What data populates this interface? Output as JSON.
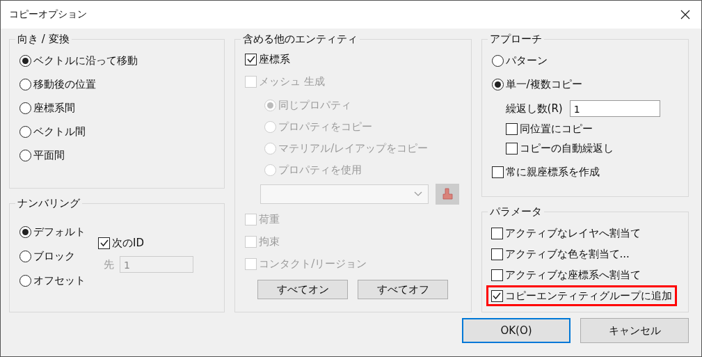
{
  "window": {
    "title": "コピーオプション"
  },
  "orientation": {
    "title": "向き / 変換",
    "options": [
      {
        "label": "ベクトルに沿って移動",
        "selected": true
      },
      {
        "label": "移動後の位置",
        "selected": false
      },
      {
        "label": "座標系間",
        "selected": false
      },
      {
        "label": "ベクトル間",
        "selected": false
      },
      {
        "label": "平面間",
        "selected": false
      }
    ]
  },
  "numbering": {
    "title": "ナンバリング",
    "options": [
      {
        "label": "デフォルト",
        "selected": true
      },
      {
        "label": "ブロック",
        "selected": false
      },
      {
        "label": "オフセット",
        "selected": false
      }
    ],
    "next_id": {
      "label": "次のID",
      "checked": true
    },
    "start": {
      "label": "先",
      "value": "1",
      "disabled": true
    }
  },
  "entities": {
    "title": "含める他のエンティティ",
    "items": [
      {
        "kind": "checkbox",
        "label": "座標系",
        "checked": true,
        "disabled": false
      },
      {
        "kind": "checkbox",
        "label": "メッシュ 生成",
        "checked": false,
        "disabled": true,
        "children": [
          {
            "kind": "radio",
            "label": "同じプロパティ",
            "selected": true,
            "disabled": true
          },
          {
            "kind": "radio",
            "label": "プロパティをコピー",
            "selected": false,
            "disabled": true
          },
          {
            "kind": "radio",
            "label": "マテリアル/レイアップをコピー",
            "selected": false,
            "disabled": true
          },
          {
            "kind": "radio",
            "label": "プロパティを使用",
            "selected": false,
            "disabled": true
          },
          {
            "kind": "combo",
            "disabled": true
          }
        ]
      },
      {
        "kind": "checkbox",
        "label": "荷重",
        "checked": false,
        "disabled": true
      },
      {
        "kind": "checkbox",
        "label": "拘束",
        "checked": false,
        "disabled": true
      },
      {
        "kind": "checkbox",
        "label": "コンタクト/リージョン",
        "checked": false,
        "disabled": true
      }
    ],
    "buttons": [
      "すべてオン",
      "すべてオフ"
    ]
  },
  "approach": {
    "title": "アプローチ",
    "items": [
      {
        "kind": "radio",
        "label": "パターン",
        "selected": false
      },
      {
        "kind": "radio",
        "label": "単一/複数コピー",
        "selected": true,
        "children": [
          {
            "kind": "field",
            "label": "繰返し数(R)",
            "value": "1"
          },
          {
            "kind": "checkbox",
            "label": "同位置にコピー",
            "checked": false
          },
          {
            "kind": "checkbox",
            "label": "コピーの自動繰返し",
            "checked": false
          }
        ]
      },
      {
        "kind": "checkbox",
        "label": "常に親座標系を作成",
        "checked": false
      }
    ]
  },
  "parameters": {
    "title": "パラメータ",
    "items": [
      {
        "label": "アクティブなレイヤへ割当て",
        "checked": false,
        "highlighted": false
      },
      {
        "label": "アクティブな色を割当て...",
        "checked": false,
        "highlighted": false
      },
      {
        "label": "アクティブな座標系へ割当て",
        "checked": false,
        "highlighted": false
      },
      {
        "label": "コピーエンティティグループに追加",
        "checked": true,
        "highlighted": true
      }
    ]
  },
  "buttons": [
    {
      "label": "OK(O)",
      "default": true
    },
    {
      "label": "キャンセル",
      "default": false
    }
  ]
}
